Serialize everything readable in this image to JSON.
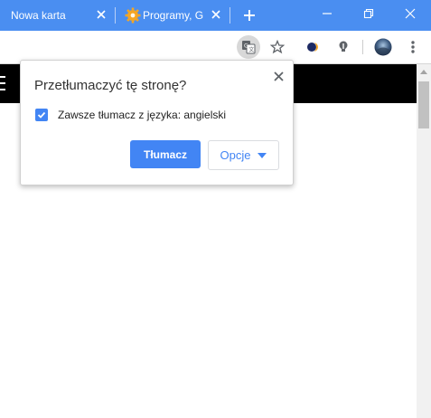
{
  "tabs": [
    {
      "title": "Nowa karta"
    },
    {
      "title": "Programy, G"
    }
  ],
  "window_controls": [
    "minimize",
    "maximize",
    "close"
  ],
  "toolbar": {
    "icons": [
      "translate-icon",
      "star-icon",
      "extension-icon",
      "lightbulb-icon",
      "profile-avatar",
      "more-menu-icon"
    ]
  },
  "popup": {
    "title": "Przetłumaczyć tę stronę?",
    "checkbox_label": "Zawsze tłumacz z języka: angielski",
    "checkbox_checked": true,
    "primary_button": "Tłumacz",
    "options_button": "Opcje"
  },
  "colors": {
    "tab_strip": "#4a8ef1",
    "accent": "#4285f4",
    "page_header": "#000000"
  }
}
